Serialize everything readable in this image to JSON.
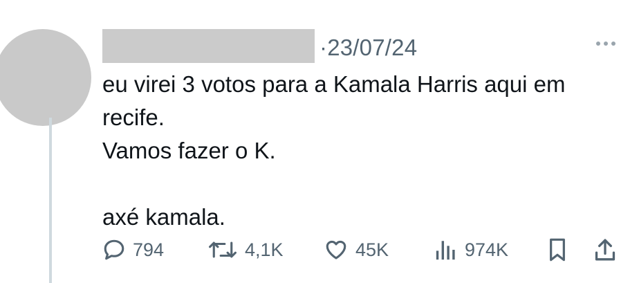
{
  "tweet": {
    "date": "·23/07/24",
    "text_lines": [
      "eu virei 3 votos para a Kamala Harris aqui em",
      "recife.",
      "Vamos fazer o K.",
      "",
      "axé kamala."
    ]
  },
  "actions": {
    "replies": "794",
    "reposts": "4,1K",
    "likes": "45K",
    "views": "974K"
  },
  "icons": {
    "reply": "speech-bubble-icon",
    "repost": "repost-arrows-icon",
    "like": "heart-icon",
    "views": "bar-chart-icon",
    "bookmark": "bookmark-icon",
    "share": "share-upload-icon",
    "more": "more-dots-icon"
  },
  "colors": {
    "text": "#0f1419",
    "muted": "#536471",
    "thread_line": "#cfd9de"
  }
}
